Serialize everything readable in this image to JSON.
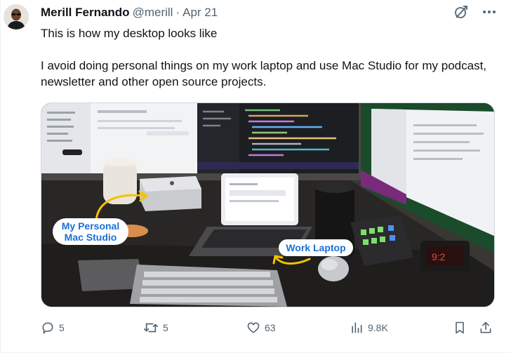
{
  "tweet": {
    "author_name": "Merill Fernando",
    "handle": "@merill",
    "separator": "·",
    "date": "Apr 21",
    "text_line1": "This is how my desktop looks like",
    "text_line2": "I avoid doing personal things on my work laptop and use  Mac Studio for my podcast, newsletter and other open source projects."
  },
  "media": {
    "callout_personal_line1": "My Personal",
    "callout_personal_line2": "Mac Studio",
    "callout_work": "Work Laptop"
  },
  "actions": {
    "replies": "5",
    "reposts": "5",
    "likes": "63",
    "views": "9.8K"
  },
  "icons": [
    "grok-icon",
    "more-icon",
    "reply-icon",
    "repost-icon",
    "like-icon",
    "views-icon",
    "bookmark-icon",
    "share-icon"
  ],
  "colors": {
    "text_primary": "#0f1419",
    "text_secondary": "#536471",
    "callout_text": "#1d6fd8",
    "arrow_yellow": "#f2c200"
  }
}
